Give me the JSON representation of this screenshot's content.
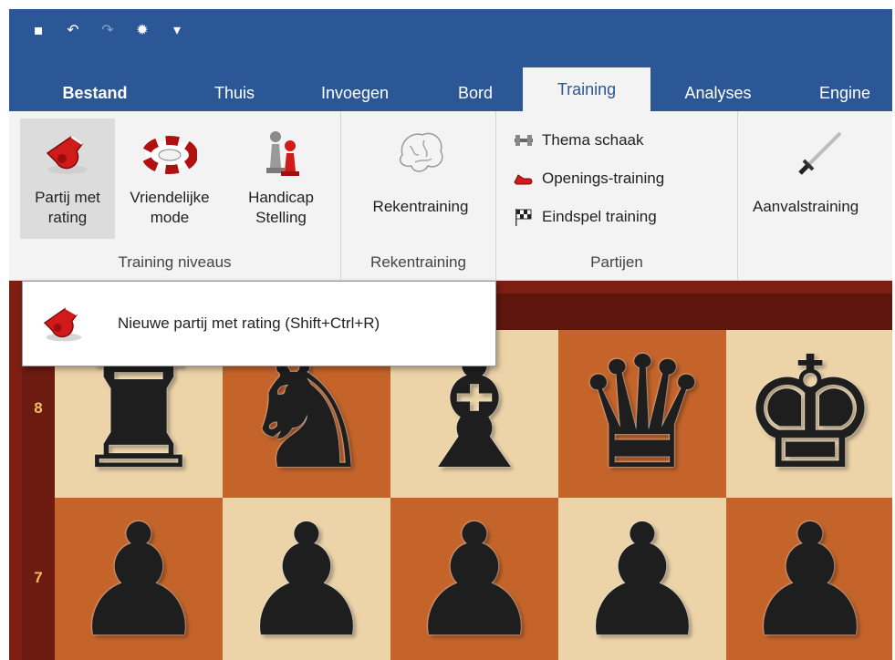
{
  "quick_access": {
    "icons": [
      "save-icon",
      "undo-icon",
      "redo-icon",
      "engine-icon",
      "customize-icon"
    ],
    "glyphs": [
      "▪",
      "↶",
      "↷",
      "✹",
      "▾"
    ]
  },
  "tabs": [
    {
      "label": "Bestand",
      "active": false
    },
    {
      "label": "Thuis",
      "active": false
    },
    {
      "label": "Invoegen",
      "active": false
    },
    {
      "label": "Bord",
      "active": false
    },
    {
      "label": "Training",
      "active": true
    },
    {
      "label": "Analyses",
      "active": false
    },
    {
      "label": "Engine",
      "active": false
    }
  ],
  "ribbon": {
    "training_niveaus": {
      "label": "Training niveaus",
      "buttons": [
        {
          "label": "Partij met\nrating",
          "icon": "whistle-icon",
          "selected": true
        },
        {
          "label": "Vriendelijke\nmode",
          "icon": "lifebuoy-icon",
          "selected": false
        },
        {
          "label": "Handicap\nStelling",
          "icon": "pawns-icon",
          "selected": false
        }
      ]
    },
    "rekentraining": {
      "label": "Rekentraining",
      "button": {
        "label": "Rekentraining",
        "icon": "brain-icon"
      }
    },
    "partijen": {
      "label": "Partijen",
      "items": [
        {
          "label": "Thema schaak",
          "icon": "dumbbell-icon"
        },
        {
          "label": "Openings-training",
          "icon": "running-shoe-icon"
        },
        {
          "label": "Eindspel training",
          "icon": "checkered-flag-icon"
        }
      ]
    },
    "aanvalstraining": {
      "button": {
        "label": "Aanvalstraining",
        "icon": "sword-icon"
      }
    }
  },
  "tooltip": {
    "text": "Nieuwe partij met rating (Shift+Ctrl+R)",
    "icon": "whistle-icon"
  },
  "board": {
    "ranks": [
      "8",
      "7"
    ],
    "rank8": [
      "♜",
      "♞",
      "♝",
      "♛",
      "♚"
    ],
    "rank7": [
      "♟",
      "♟",
      "♟",
      "♟",
      "♟"
    ]
  },
  "colors": {
    "accent": "#2b5797",
    "ribbon_bg": "#f3f3f3",
    "light_square": "#ecd3a8",
    "dark_square": "#c4642a"
  }
}
